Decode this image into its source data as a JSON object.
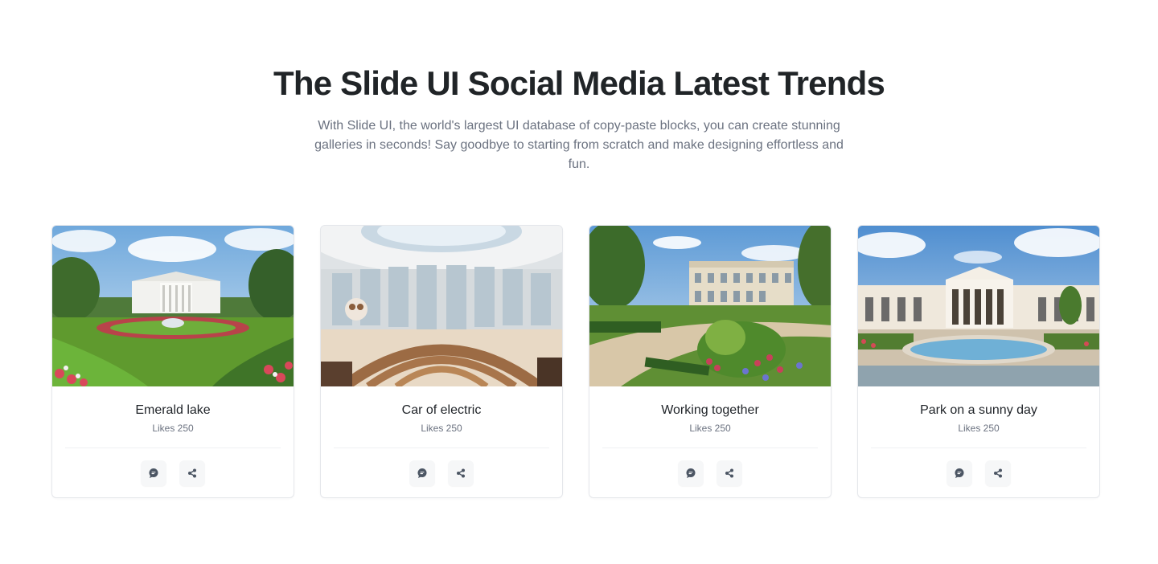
{
  "section": {
    "title": "The Slide UI Social Media Latest Trends",
    "description": "With Slide UI, the world's largest UI database of copy-paste blocks, you can create stunning galleries in seconds! Say goodbye to starting from scratch and make designing effortless and fun."
  },
  "cards": [
    {
      "title": "Emerald lake",
      "likes": "Likes 250",
      "image_icon": "white-house-garden-image",
      "comment_icon": "chat-bubble-icon",
      "share_icon": "share-icon"
    },
    {
      "title": "Car of electric",
      "likes": "Likes 250",
      "image_icon": "round-hall-interior-image",
      "comment_icon": "chat-bubble-icon",
      "share_icon": "share-icon"
    },
    {
      "title": "Working together",
      "likes": "Likes 250",
      "image_icon": "mansion-garden-image",
      "comment_icon": "chat-bubble-icon",
      "share_icon": "share-icon"
    },
    {
      "title": "Park on a sunny day",
      "likes": "Likes 250",
      "image_icon": "palace-pool-image",
      "comment_icon": "chat-bubble-icon",
      "share_icon": "share-icon"
    }
  ],
  "colors": {
    "heading": "#202427",
    "body_text": "#6b7280",
    "card_border": "#e5e7eb",
    "icon": "#4b5563"
  }
}
